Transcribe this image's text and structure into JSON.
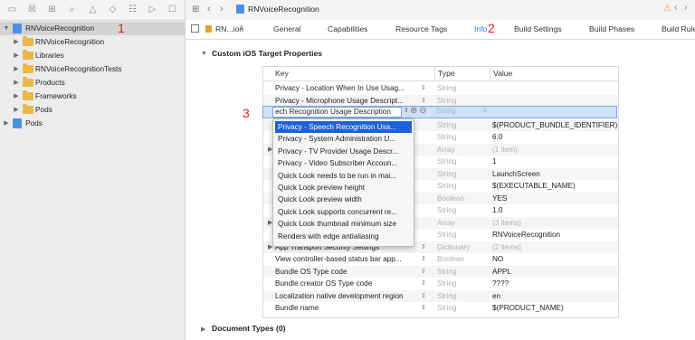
{
  "colors": {
    "accent": "#2a7be4",
    "annotation": "#e02020",
    "selection": "#1c62d6",
    "folder": "#e9b946"
  },
  "navigator": {
    "toolbar_icons": [
      "folder-icon",
      "source-control-icon",
      "hierarchy-icon",
      "search-icon",
      "issue-warning-icon",
      "test-icon",
      "debug-icon",
      "breakpoint-icon",
      "report-icon"
    ],
    "items": [
      {
        "label": "RNVoiceRecognition",
        "kind": "project"
      },
      {
        "label": "RNVoiceRecognition",
        "kind": "folder"
      },
      {
        "label": "Libraries",
        "kind": "folder"
      },
      {
        "label": "RNVoiceRecognitionTests",
        "kind": "folder"
      },
      {
        "label": "Products",
        "kind": "folder"
      },
      {
        "label": "Frameworks",
        "kind": "folder"
      },
      {
        "label": "Pods",
        "kind": "folder"
      },
      {
        "label": "Pods",
        "kind": "project"
      }
    ]
  },
  "annotations": {
    "one": "1",
    "two": "2",
    "three": "3"
  },
  "editor": {
    "breadcrumb": "RNVoiceRecognition",
    "target_label": "RN...ion",
    "tabs": [
      "General",
      "Capabilities",
      "Resource Tags",
      "Info",
      "Build Settings",
      "Build Phases",
      "Build Rule"
    ],
    "active_tab": "Info",
    "section_title": "Custom iOS Target Properties",
    "document_types": "Document Types (0)"
  },
  "table": {
    "headers": {
      "key": "Key",
      "type": "Type",
      "value": "Value"
    },
    "rows": [
      {
        "key": "Privacy - Location When In Use Usag...",
        "type": "String",
        "value": ""
      },
      {
        "key": "Privacy - Microphone Usage Descript...",
        "type": "String",
        "value": ""
      },
      {
        "key": "",
        "type": "String",
        "value": ""
      },
      {
        "key": "",
        "type": "String",
        "value": "$(PRODUCT_BUNDLE_IDENTIFIER)"
      },
      {
        "key": "",
        "type": "String",
        "value": "6.0"
      },
      {
        "key": "",
        "type": "Array",
        "value": "(1 item)"
      },
      {
        "key": "",
        "type": "String",
        "value": "1"
      },
      {
        "key": "",
        "type": "String",
        "value": "LaunchScreen"
      },
      {
        "key": "",
        "type": "String",
        "value": "$(EXECUTABLE_NAME)"
      },
      {
        "key": "",
        "type": "Boolean",
        "value": "YES"
      },
      {
        "key": "",
        "type": "String",
        "value": "1.0"
      },
      {
        "key": "",
        "type": "Array",
        "value": "(3 items)"
      },
      {
        "key": "",
        "type": "String",
        "value": "RNVoiceRecognition"
      },
      {
        "key": "App Transport Security Settings",
        "type": "Dictionary",
        "value": "(2 items)"
      },
      {
        "key": "View controller-based status bar app...",
        "type": "Boolean",
        "value": "NO"
      },
      {
        "key": "Bundle OS Type code",
        "type": "String",
        "value": "APPL"
      },
      {
        "key": "Bundle creator OS Type code",
        "type": "String",
        "value": "????"
      },
      {
        "key": "Localization native development region",
        "type": "String",
        "value": "en"
      },
      {
        "key": "Bundle name",
        "type": "String",
        "value": "$(PRODUCT_NAME)"
      }
    ],
    "editing_value": "ech Recognition Usage Description"
  },
  "popup": {
    "items": [
      "Privacy - Speech Recognition Usa...",
      "Privacy - System Administration U...",
      "Privacy - TV Provider Usage Descr...",
      "Privacy - Video Subscriber Accoun...",
      "Quick Look needs to be run in mai...",
      "Quick Look preview height",
      "Quick Look preview width",
      "Quick Look supports concurrent re...",
      "Quick Look thumbnail minimum size",
      "Renders with edge antialiasing"
    ],
    "highlighted": 0
  }
}
